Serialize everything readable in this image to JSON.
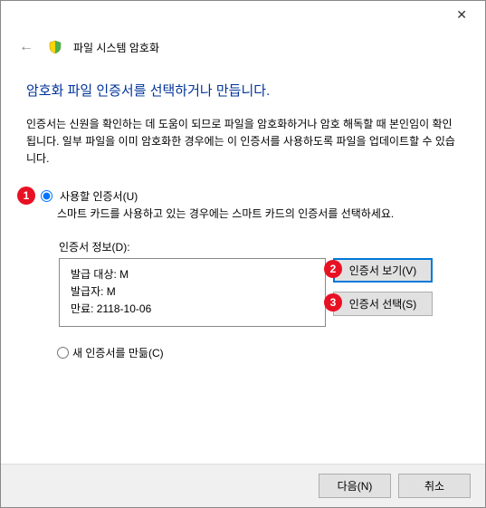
{
  "window": {
    "title": "파일 시스템 암호화"
  },
  "heading": "암호화 파일 인증서를 선택하거나 만듭니다.",
  "description": "인증서는 신원을 확인하는 데 도움이 되므로 파일을 암호화하거나 암호 해독할 때 본인임이 확인됩니다. 일부 파일을 이미 암호화한 경우에는 이 인증서를 사용하도록 파일을 업데이트할 수 있습니다.",
  "radio1": {
    "label": "사용할 인증서(U)",
    "hint": "스마트 카드를 사용하고 있는 경우에는 스마트 카드의 인증서를 선택하세요."
  },
  "certInfo": {
    "label": "인증서 정보(D):",
    "issuedTo": "발급 대상: M",
    "issuer": "발급자: M",
    "expires": "만료: 2118-10-06"
  },
  "buttons": {
    "viewCert": "인증서 보기(V)",
    "selectCert": "인증서 선택(S)"
  },
  "radio2": {
    "label": "새 인증서를 만듦(C)"
  },
  "footer": {
    "next": "다음(N)",
    "cancel": "취소"
  },
  "markers": {
    "m1": "1",
    "m2": "2",
    "m3": "3"
  }
}
